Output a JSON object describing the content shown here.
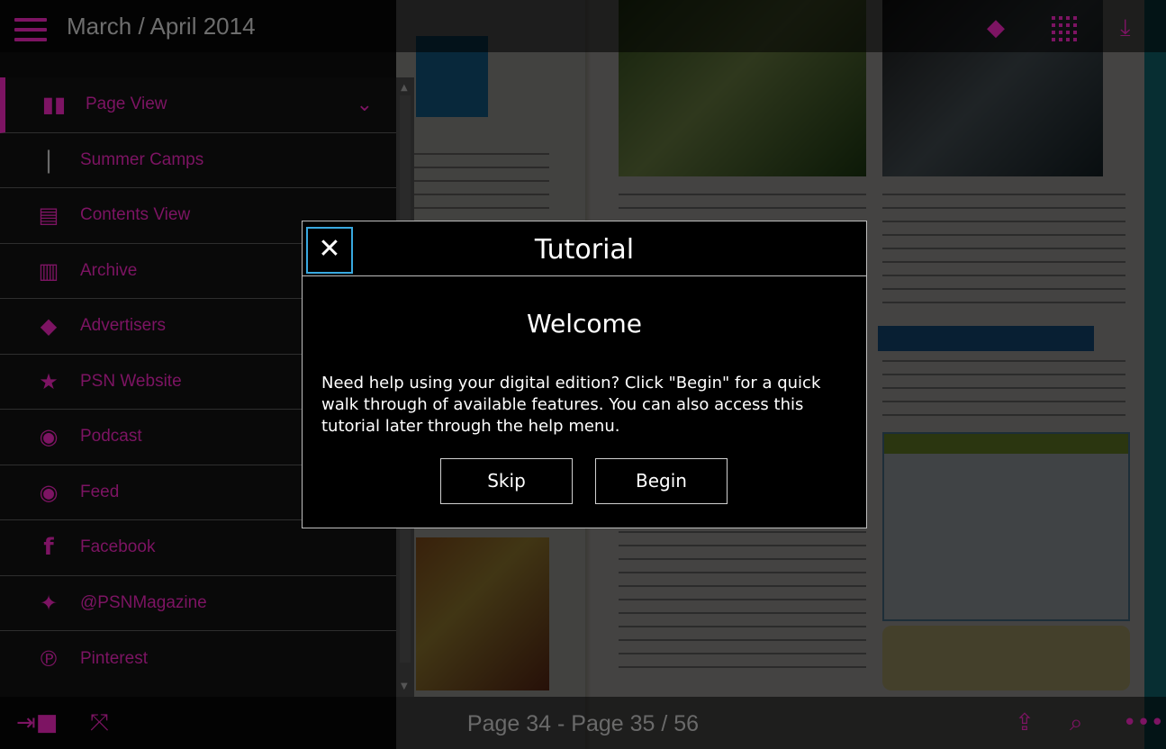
{
  "header": {
    "title": "March / April 2014"
  },
  "sidebar": {
    "items": [
      {
        "label": "Page View",
        "icon": "book-open-icon",
        "glyph": "▮▮",
        "chevron": "⌄"
      },
      {
        "label": "Summer Camps",
        "icon": "sub-item-bar-icon",
        "glyph": "|"
      },
      {
        "label": "Contents View",
        "icon": "list-document-icon",
        "glyph": "▤"
      },
      {
        "label": "Archive",
        "icon": "books-icon",
        "glyph": "▥"
      },
      {
        "label": "Advertisers",
        "icon": "tag-icon",
        "glyph": "◆"
      },
      {
        "label": "PSN Website",
        "icon": "star-icon",
        "glyph": "★"
      },
      {
        "label": "Podcast",
        "icon": "rss-icon",
        "glyph": "◉"
      },
      {
        "label": "Feed",
        "icon": "rss-icon",
        "glyph": "◉"
      },
      {
        "label": "Facebook",
        "icon": "facebook-icon",
        "glyph": "f"
      },
      {
        "label": "@PSNMagazine",
        "icon": "twitter-icon",
        "glyph": "✦"
      },
      {
        "label": "Pinterest",
        "icon": "pinterest-icon",
        "glyph": "℗"
      }
    ]
  },
  "footer": {
    "page_indicator": "Page 34 - Page 35 / 56"
  },
  "tutorial": {
    "title": "Tutorial",
    "close_glyph": "✕",
    "heading": "Welcome",
    "body": "Need help using your digital edition? Click \"Begin\" for a quick walk through of available features. You can also access this tutorial later through the help menu.",
    "skip_label": "Skip",
    "begin_label": "Begin"
  },
  "colors": {
    "accent": "#7d1463",
    "modal_border": "#bdbdbd",
    "close_focus": "#38a8e0"
  }
}
